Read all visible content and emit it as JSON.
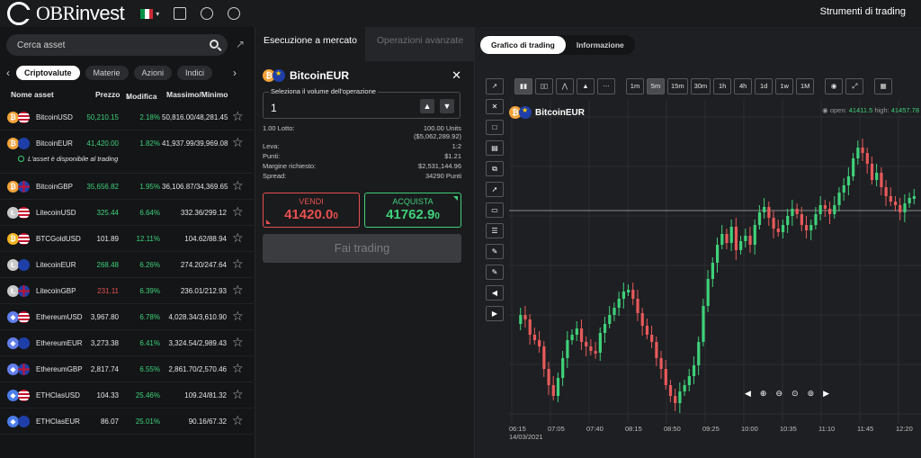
{
  "header": {
    "brand_bold": "OBR",
    "brand_light": "invest",
    "tools_title": "Strumenti di trading",
    "icons": [
      "italy-flag-icon",
      "chevron-down-icon",
      "fullscreen-icon",
      "info-icon",
      "headset-icon"
    ]
  },
  "asset_list": {
    "search_placeholder": "Cerca asset",
    "categories": [
      "Criptovalute",
      "Materie",
      "Azioni",
      "Indici"
    ],
    "active_category": "Criptovalute",
    "columns": {
      "name": "Nome asset",
      "price": "Prezzo",
      "change": "Modifica",
      "range": "Massimo/Minimo"
    },
    "items": [
      {
        "name": "BitcoinUSD",
        "price": "50,210.15",
        "price_color": "green",
        "change": "2.18%",
        "range": "50,816.00/48,281.45",
        "icon": "bitcoin-icon",
        "flag": "usa-flag-icon"
      },
      {
        "name": "BitcoinEUR",
        "price": "41,420.00",
        "price_color": "green",
        "change": "1.82%",
        "range": "41,937.99/39,969.08",
        "icon": "bitcoin-icon",
        "flag": "eu-flag-icon",
        "note": "L'asset è disponibile al trading"
      },
      {
        "name": "BitcoinGBP",
        "price": "35,656.82",
        "price_color": "green",
        "change": "1.95%",
        "range": "36,106.87/34,369.65",
        "icon": "bitcoin-icon",
        "flag": "uk-flag-icon"
      },
      {
        "name": "LitecoinUSD",
        "price": "325.44",
        "price_color": "green",
        "change": "6.64%",
        "range": "332.36/299.12",
        "icon": "litecoin-icon",
        "flag": "usa-flag-icon"
      },
      {
        "name": "BTCGoldUSD",
        "price": "101.89",
        "price_color": "white",
        "change": "12.11%",
        "range": "104.62/88.94",
        "icon": "bitcoin-gold-icon",
        "flag": "usa-flag-icon"
      },
      {
        "name": "LitecoinEUR",
        "price": "268.48",
        "price_color": "green",
        "change": "6.26%",
        "range": "274.20/247.64",
        "icon": "litecoin-icon",
        "flag": "eu-flag-icon"
      },
      {
        "name": "LitecoinGBP",
        "price": "231.11",
        "price_color": "red",
        "change": "6.39%",
        "range": "236.01/212.93",
        "icon": "litecoin-icon",
        "flag": "uk-flag-icon"
      },
      {
        "name": "EthereumUSD",
        "price": "3,967.80",
        "price_color": "white",
        "change": "6.78%",
        "range": "4,028.34/3,610.90",
        "icon": "ethereum-icon",
        "flag": "usa-flag-icon"
      },
      {
        "name": "EthereumEUR",
        "price": "3,273.38",
        "price_color": "white",
        "change": "6.41%",
        "range": "3,324.54/2,989.43",
        "icon": "ethereum-icon",
        "flag": "eu-flag-icon"
      },
      {
        "name": "EthereumGBP",
        "price": "2,817.74",
        "price_color": "white",
        "change": "6.55%",
        "range": "2,861.70/2,570.46",
        "icon": "ethereum-icon",
        "flag": "uk-flag-icon"
      },
      {
        "name": "ETHClasUSD",
        "price": "104.33",
        "price_color": "white",
        "change": "25.46%",
        "range": "109.24/81.32",
        "icon": "ethereum-classic-icon",
        "flag": "usa-flag-icon"
      },
      {
        "name": "ETHClasEUR",
        "price": "86.07",
        "price_color": "white",
        "change": "25.01%",
        "range": "90.16/67.32",
        "icon": "ethereum-classic-icon",
        "flag": "eu-flag-icon"
      }
    ]
  },
  "trade_panel": {
    "tabs": [
      "Esecuzione a mercato",
      "Operazioni avanzate"
    ],
    "asset": "BitcoinEUR",
    "volume_label": "Seleziona il volume dell'operazione",
    "volume_value": "1",
    "info": [
      {
        "label": "1.00 Lotto:",
        "value": "100.00 Units\n($5,062,289.92)"
      },
      {
        "label": "Leva:",
        "value": "1:2"
      },
      {
        "label": "Punti:",
        "value": "$1.21"
      },
      {
        "label": "Margine richiesto:",
        "value": "$2,531,144.96"
      },
      {
        "label": "Spread:",
        "value": "34290 Punti"
      }
    ],
    "sell_label": "VENDI",
    "sell_price": "41420.0",
    "sell_price_suffix": "0",
    "buy_label": "ACQUISTA",
    "buy_price": "41762.9",
    "buy_price_suffix": "0",
    "submit_label": "Fai trading"
  },
  "chart_panel": {
    "tabs": [
      "Grafico di trading",
      "Informazione"
    ],
    "asset": "BitcoinEUR",
    "ohlc_open_label": "open:",
    "ohlc_open_value": "41411.5",
    "ohlc_high_label": "high:",
    "ohlc_high_value": "41457.78",
    "timeframes": [
      "1m",
      "5m",
      "15m",
      "30m",
      "1h",
      "4h",
      "1d",
      "1w",
      "1M"
    ],
    "active_timeframe": "5m",
    "time_labels": [
      "06:15",
      "07:05",
      "07:40",
      "08:15",
      "08:50",
      "09:25",
      "10:00",
      "10:35",
      "11:10",
      "11:45",
      "12:20"
    ],
    "date_label": "14/03/2021",
    "up_color": "#3fd17a",
    "down_color": "#e85a5a"
  }
}
